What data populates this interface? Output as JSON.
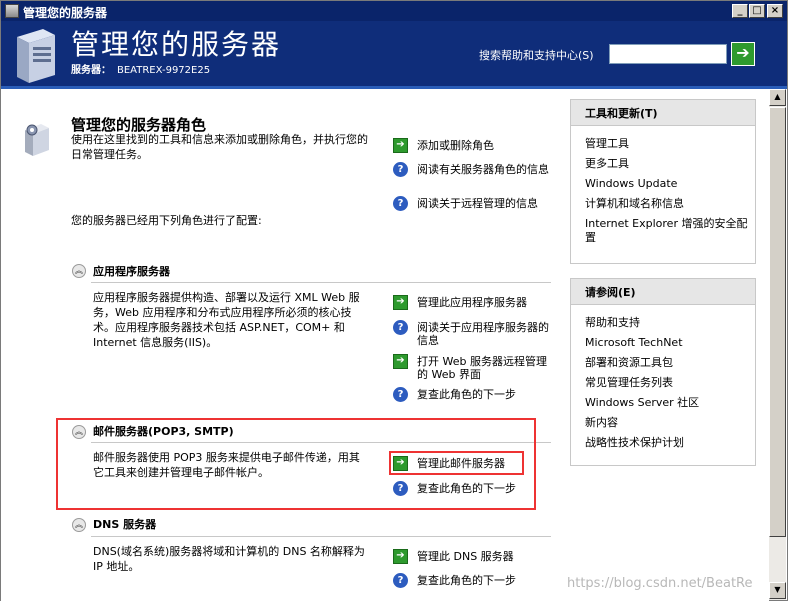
{
  "window": {
    "title": "管理您的服务器",
    "buttons": [
      "_",
      "□",
      "×"
    ]
  },
  "header": {
    "title": "管理您的服务器",
    "server_label": "服务器：",
    "server_name": "BEATREX-9972E25",
    "search_label": "搜索帮助和支持中心(S)",
    "search_value": "",
    "go_icon": "green-arrow-icon"
  },
  "main": {
    "heading": "管理您的服务器角色",
    "description": "使用在这里找到的工具和信息来添加或删除角色，并执行您的日常管理任务。",
    "top_actions": [
      {
        "icon": "go",
        "label": "添加或删除角色"
      },
      {
        "icon": "help",
        "label": "阅读有关服务器角色的信息"
      },
      {
        "icon": "help",
        "label": "阅读关于远程管理的信息"
      }
    ],
    "configured_text": "您的服务器已经用下列角色进行了配置:",
    "roles": [
      {
        "title": "应用程序服务器",
        "description": "应用程序服务器提供构造、部署以及运行 XML Web 服务，Web 应用程序和分布式应用程序所必须的核心技术。应用程序服务器技术包括 ASP.NET，COM+ 和 Internet 信息服务(IIS)。",
        "actions": [
          {
            "icon": "go",
            "label": "管理此应用程序服务器"
          },
          {
            "icon": "help",
            "label": "阅读关于应用程序服务器的信息"
          },
          {
            "icon": "go",
            "label": "打开 Web 服务器远程管理的 Web 界面"
          },
          {
            "icon": "help",
            "label": "复查此角色的下一步"
          }
        ]
      },
      {
        "title": "邮件服务器(POP3, SMTP)",
        "description": "邮件服务器使用 POP3 服务来提供电子邮件传递，用其它工具来创建并管理电子邮件帐户。",
        "actions": [
          {
            "icon": "go",
            "label": "管理此邮件服务器"
          },
          {
            "icon": "help",
            "label": "复查此角色的下一步"
          }
        ]
      },
      {
        "title": "DNS 服务器",
        "description": "DNS(域名系统)服务器将域和计算机的 DNS 名称解释为 IP 地址。",
        "actions": [
          {
            "icon": "go",
            "label": "管理此 DNS 服务器"
          },
          {
            "icon": "help",
            "label": "复查此角色的下一步"
          }
        ]
      }
    ]
  },
  "right": {
    "tools": {
      "title": "工具和更新(T)",
      "items": [
        "管理工具",
        "更多工具",
        "Windows Update",
        "计算机和域名称信息",
        "Internet Explorer 增强的安全配置"
      ]
    },
    "see_also": {
      "title": "请参阅(E)",
      "items": [
        "帮助和支持",
        "Microsoft TechNet",
        "部署和资源工具包",
        "常见管理任务列表",
        "Windows Server 社区",
        "新内容",
        "战略性技术保护计划"
      ]
    }
  },
  "watermark": "https://blog.csdn.net/BeatRe",
  "colors": {
    "title_bar": "#0a246a",
    "header": "#0f2d7a",
    "highlight": "#ee3333",
    "go_green": "#2e9a2e"
  }
}
